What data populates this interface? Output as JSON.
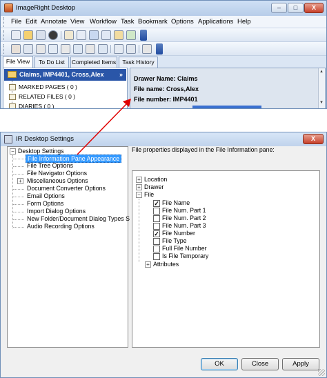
{
  "top_window": {
    "title": "ImageRight Desktop",
    "controls": {
      "minimize": "–",
      "maximize": "□",
      "close": "X"
    },
    "menu": [
      "File",
      "Edit",
      "Annotate",
      "View",
      "Workflow",
      "Task",
      "Bookmark",
      "Options",
      "Applications",
      "Help"
    ],
    "tabs": [
      "File View",
      "To Do List",
      "Completed Items",
      "Task History"
    ],
    "folder_header": "Claims, IMP4401, Cross,Alex",
    "folder_caret": "»",
    "tree_items": [
      "MARKED PAGES ( 0 )",
      "RELATED FILES ( 0 )",
      "DIARIES ( 0 )"
    ],
    "info": {
      "drawer_name": "Drawer Name: Claims",
      "file_name": "File name: Cross,Alex",
      "file_number": "File number: IMP4401"
    },
    "scroll_up": "▲",
    "scroll_down": "▼"
  },
  "dialog": {
    "title": "IR Desktop Settings",
    "close": "X",
    "left_tree": {
      "root": "Desktop Settings",
      "items": [
        {
          "label": "File Information Pane Appearance",
          "selected": true,
          "expandable": false
        },
        {
          "label": "File Tree Options",
          "expandable": false
        },
        {
          "label": "File Navigator Options",
          "expandable": false
        },
        {
          "label": "Miscellaneous Options",
          "expandable": true
        },
        {
          "label": "Document Converter Options",
          "expandable": false
        },
        {
          "label": "Email Options",
          "expandable": false
        },
        {
          "label": "Form Options",
          "expandable": false
        },
        {
          "label": "Import Dialog Options",
          "expandable": false
        },
        {
          "label": "New Folder/Document Dialog Types S",
          "expandable": false
        },
        {
          "label": "Audio Recording Options",
          "expandable": false
        }
      ]
    },
    "right_title": "File properties displayed in the File Information pane:",
    "properties_tree": {
      "location": "Location",
      "drawer": "Drawer",
      "file": "File",
      "file_fields": [
        {
          "label": "File Name",
          "checked": true
        },
        {
          "label": "File Num. Part 1",
          "checked": false
        },
        {
          "label": "File Num. Part 2",
          "checked": false
        },
        {
          "label": "File Num. Part 3",
          "checked": false
        },
        {
          "label": "File Number",
          "checked": true
        },
        {
          "label": "File Type",
          "checked": false
        },
        {
          "label": "Full File Number",
          "checked": false
        },
        {
          "label": "Is File Temporary",
          "checked": false
        }
      ],
      "attributes": "Attributes"
    },
    "expander_plus": "+",
    "expander_minus": "−",
    "check_mark": "✓",
    "buttons": {
      "ok": "OK",
      "close": "Close",
      "apply": "Apply"
    }
  },
  "colors": {
    "selection": "#3399ff",
    "folder_header": "#2a56a8",
    "annotation_arrow": "#e00000"
  }
}
